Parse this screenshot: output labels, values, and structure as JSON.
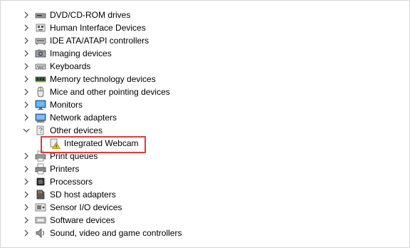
{
  "device_tree": {
    "items": [
      {
        "label": "DVD/CD-ROM drives",
        "icon": "dvd-drive-icon",
        "expanded": false
      },
      {
        "label": "Human Interface Devices",
        "icon": "hid-icon",
        "expanded": false
      },
      {
        "label": "IDE ATA/ATAPI controllers",
        "icon": "ide-controller-icon",
        "expanded": false
      },
      {
        "label": "Imaging devices",
        "icon": "camera-icon",
        "expanded": false
      },
      {
        "label": "Keyboards",
        "icon": "keyboard-icon",
        "expanded": false
      },
      {
        "label": "Memory technology devices",
        "icon": "memory-icon",
        "expanded": false
      },
      {
        "label": "Mice and other pointing devices",
        "icon": "mouse-icon",
        "expanded": false
      },
      {
        "label": "Monitors",
        "icon": "monitor-icon",
        "expanded": false
      },
      {
        "label": "Network adapters",
        "icon": "network-adapter-icon",
        "expanded": false
      },
      {
        "label": "Other devices",
        "icon": "other-devices-icon",
        "expanded": true,
        "children": [
          {
            "label": "Integrated Webcam",
            "icon": "warning-device-icon",
            "highlighted": true
          }
        ]
      },
      {
        "label": "Print queues",
        "icon": "print-queue-icon",
        "expanded": false
      },
      {
        "label": "Printers",
        "icon": "printer-icon",
        "expanded": false
      },
      {
        "label": "Processors",
        "icon": "processor-icon",
        "expanded": false
      },
      {
        "label": "SD host adapters",
        "icon": "sd-card-icon",
        "expanded": false
      },
      {
        "label": "Sensor I/O devices",
        "icon": "sensor-icon",
        "expanded": false
      },
      {
        "label": "Software devices",
        "icon": "software-device-icon",
        "expanded": false
      },
      {
        "label": "Sound, video and game controllers",
        "icon": "speaker-icon",
        "expanded": false
      }
    ]
  },
  "colors": {
    "highlight_border": "#e03a3a",
    "warning": "#f2c200",
    "chevron": "#555555"
  }
}
